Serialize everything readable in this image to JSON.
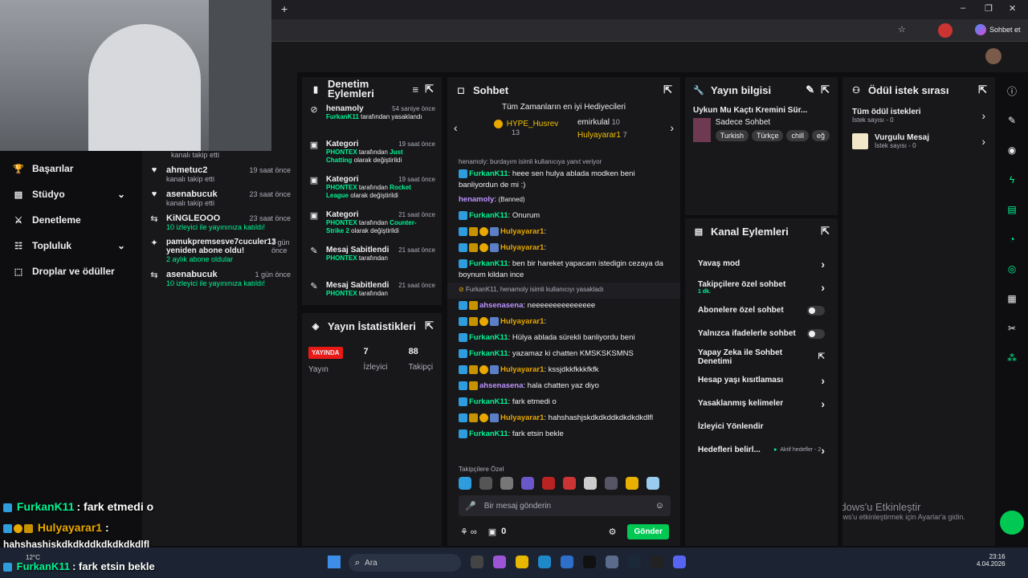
{
  "browser": {
    "profile_label": "Sohbet et",
    "new_tab": "+"
  },
  "sidebar": {
    "items": [
      {
        "label": "Başarılar",
        "icon": "trophy-icon"
      },
      {
        "label": "Stüdyo",
        "icon": "studio-icon",
        "expand": true
      },
      {
        "label": "Denetleme",
        "icon": "sword-icon"
      },
      {
        "label": "Topluluk",
        "icon": "community-icon",
        "expand": true
      },
      {
        "label": "Droplar ve ödüller",
        "icon": "drops-icon"
      }
    ]
  },
  "activity": [
    {
      "name": "",
      "desc": "kanalı takip etti",
      "time": "",
      "icon": "heart-icon"
    },
    {
      "name": "ahmetuc2",
      "desc": "kanalı takip etti",
      "time": "19 saat önce",
      "icon": "heart-icon"
    },
    {
      "name": "asenabucuk",
      "desc": "kanalı takip etti",
      "time": "23 saat önce",
      "icon": "heart-icon"
    },
    {
      "name": "KiNGLEOOO",
      "desc": "10 izleyici ile yayınınıza katıldı!",
      "time": "23 saat önce",
      "icon": "raid-icon"
    },
    {
      "name": "pamukpremsesve7cuculer13 yeniden abone oldu!",
      "desc": "2 aylık abone oldular",
      "time": "1 gün önce",
      "icon": "star-icon"
    },
    {
      "name": "asenabucuk",
      "desc": "10 izleyici ile yayınınıza katıldı!",
      "time": "1 gün önce",
      "icon": "raid-icon"
    }
  ],
  "mod_actions": {
    "title": "Denetim Eylemleri",
    "items": [
      {
        "title": "henamoly",
        "time": "54 saniye önce",
        "user": "FurkanK11",
        "rest": "tarafından yasaklandı",
        "icon": "ban-icon"
      },
      {
        "title": "Kategori",
        "time": "19 saat önce",
        "user": "PHONTEX",
        "rest": "tarafından",
        "value": "Just Chatting",
        "tail": "olarak değiştirildi",
        "icon": "category-icon"
      },
      {
        "title": "Kategori",
        "time": "19 saat önce",
        "user": "PHONTEX",
        "rest": "tarafından",
        "value": "Rocket League",
        "tail": "olarak değiştirildi",
        "icon": "category-icon"
      },
      {
        "title": "Kategori",
        "time": "21 saat önce",
        "user": "PHONTEX",
        "rest": "tarafından",
        "value": "Counter-Strike 2",
        "tail": "olarak değiştirildi",
        "icon": "category-icon"
      },
      {
        "title": "Mesaj Sabitlendi",
        "time": "21 saat önce",
        "user": "PHONTEX",
        "rest": "tarafından",
        "icon": "pin-icon"
      },
      {
        "title": "Mesaj Sabitlendi",
        "time": "21 saat önce",
        "user": "PHONTEX",
        "rest": "tarafından",
        "icon": "pin-icon"
      }
    ]
  },
  "stats": {
    "title": "Yayın İstatistikleri",
    "live": "YAYINDA",
    "live_label": "Yayın",
    "viewers": "7",
    "viewers_label": "İzleyici",
    "followers": "88",
    "followers_label": "Takipçi"
  },
  "chat": {
    "title": "Sohbet",
    "gifters_title": "Tüm Zamanların en iyi Hediyecileri",
    "gifters": [
      {
        "name": "HYPE_Husrev",
        "count": "13"
      },
      {
        "name": "emirkulal",
        "count": "10"
      },
      {
        "name": "Hulyayarar1",
        "count": "7"
      }
    ],
    "reply_ctx": "henamoly: burdayım isimli kullanıcıya yanıt veriyor",
    "messages": [
      {
        "user": "FurkanK11",
        "color": "#00f593",
        "text": ": heee sen hulya ablada modken beni banliyordun de mi :)"
      },
      {
        "user": "henamoly",
        "color": "#bf94ff",
        "text": ":",
        "extra": "(Banned)"
      },
      {
        "user": "FurkanK11",
        "color": "#00f593",
        "text": ": Onurum"
      },
      {
        "user": "Hulyayarar1",
        "color": "#e8a800",
        "text": ":"
      },
      {
        "user": "Hulyayarar1",
        "color": "#e8a800",
        "text": ":"
      },
      {
        "user": "FurkanK11",
        "color": "#00f593",
        "text": ": ben bir hareket yapacam istedigin cezaya da boynum kildan ince"
      },
      {
        "system": "FurkanK11, henamoly isimli kullanıcıyı yasakladı"
      },
      {
        "user": "ahsenasena",
        "color": "#bf94ff",
        "text": ": neeeeeeeeeeeeeee"
      },
      {
        "user": "Hulyayarar1",
        "color": "#e8a800",
        "text": ":"
      },
      {
        "user": "FurkanK11",
        "color": "#00f593",
        "text": ": Hülya ablada sürekli banliyordu beni"
      },
      {
        "user": "FurkanK11",
        "color": "#00f593",
        "text": ": yazamaz ki chatten KMSKSKSMNS"
      },
      {
        "user": "Hulyayarar1",
        "color": "#e8a800",
        "text": ": kssjdkkfkkkfkfk"
      },
      {
        "user": "ahsenasena",
        "color": "#bf94ff",
        "text": ": hala chatten yaz diyo"
      },
      {
        "user": "FurkanK11",
        "color": "#00f593",
        "text": ": fark etmedi o"
      },
      {
        "user": "Hulyayarar1",
        "color": "#e8a800",
        "text": ": hahshashjskdkdkddkdkdkdkdlfl"
      },
      {
        "user": "FurkanK11",
        "color": "#00f593",
        "text": ": fark etsin bekle"
      }
    ],
    "followers_only": "Takipçilere Özel",
    "input_placeholder": "Bir mesaj gönderin",
    "points": "0",
    "send": "Gönder"
  },
  "stream_info": {
    "title": "Yayın bilgisi",
    "stream_title": "Uykun Mu Kaçtı Kremini Sür...",
    "category": "Sadece Sohbet",
    "tags": [
      "Turkish",
      "Türkçe",
      "chill",
      "eğ"
    ]
  },
  "channel_actions": {
    "title": "Kanal Eylemleri",
    "items": [
      {
        "label": "Yavaş mod",
        "kind": "arrow"
      },
      {
        "label": "Takipçilere özel sohbet",
        "sub": "1 dk.",
        "kind": "arrow"
      },
      {
        "label": "Abonelere özel sohbet",
        "kind": "toggle"
      },
      {
        "label": "Yalnızca ifadelerle sohbet",
        "kind": "toggle"
      },
      {
        "label": "Yapay Zeka ile Sohbet Denetimi",
        "kind": "link"
      },
      {
        "label": "Hesap yaşı kısıtlaması",
        "kind": "arrow"
      },
      {
        "label": "Yasaklanmış kelimeler",
        "kind": "arrow"
      },
      {
        "label": "İzleyici Yönlendir",
        "kind": "none"
      },
      {
        "label": "Hedefleri belirl...",
        "sub": "Aktif hedefler - 2",
        "kind": "arrow"
      }
    ]
  },
  "rewards": {
    "title": "Ödül istek sırası",
    "items": [
      {
        "label": "Tüm ödül istekleri",
        "sub": "İstek sayısı - 0"
      },
      {
        "label": "Vurgulu Mesaj",
        "sub": "İstek sayısı - 0"
      }
    ]
  },
  "overlay": {
    "l1_user": "FurkanK11",
    "l1_text": ": fark etmedi o",
    "l2_user": "Hulyayarar1",
    "l2_sep": ":",
    "l2_text": "hahshashjskdkdkddkdkdkdkdlfl",
    "l3_user": "FurkanK11",
    "l3_text": ": fark etsin bekle"
  },
  "watermark": {
    "line1": "Windows'u Etkinleştir",
    "line2": "Windows'u etkinleştirmek için Ayarlar'a gidin."
  },
  "taskbar": {
    "search": "Ara",
    "time": "23:16",
    "date": "4.04.2026",
    "temp": "12°C"
  }
}
